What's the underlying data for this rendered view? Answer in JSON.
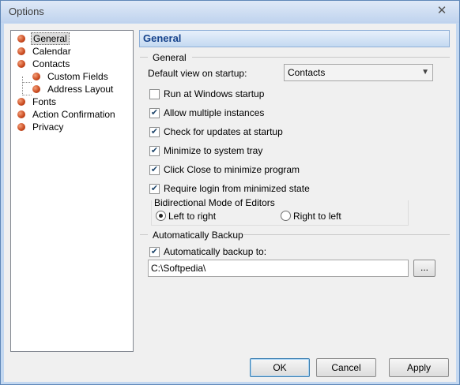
{
  "window": {
    "title": "Options",
    "close_glyph": "✕"
  },
  "tree": {
    "items": [
      {
        "label": "General",
        "level": 0,
        "selected": true
      },
      {
        "label": "Calendar",
        "level": 0
      },
      {
        "label": "Contacts",
        "level": 0
      },
      {
        "label": "Custom Fields",
        "level": 1
      },
      {
        "label": "Address Layout",
        "level": 1
      },
      {
        "label": "Fonts",
        "level": 0
      },
      {
        "label": "Action Confirmation",
        "level": 0
      },
      {
        "label": "Privacy",
        "level": 0
      }
    ]
  },
  "panel": {
    "header": "General",
    "general_group": "General",
    "default_view_label": "Default view on startup:",
    "default_view_value": "Contacts",
    "checkboxes": [
      {
        "label": "Run at Windows startup",
        "checked": false
      },
      {
        "label": "Allow multiple instances",
        "checked": true
      },
      {
        "label": "Check for updates at startup",
        "checked": true
      },
      {
        "label": "Minimize to system tray",
        "checked": true
      },
      {
        "label": "Click Close to minimize program",
        "checked": true
      },
      {
        "label": "Require login from minimized state",
        "checked": true
      }
    ],
    "bidi_group": "Bidirectional Mode of Editors",
    "radio_ltr": "Left to right",
    "radio_rtl": "Right to left",
    "backup_group": "Automatically Backup",
    "backup_check": "Automatically backup to:",
    "backup_path": "C:\\Softpedia\\",
    "browse_label": "..."
  },
  "buttons": {
    "ok": "OK",
    "cancel": "Cancel",
    "apply": "Apply"
  },
  "colors": {
    "header_text": "#15428b",
    "title_bar": "#bfd3ee",
    "bullet": "#c8481d"
  }
}
